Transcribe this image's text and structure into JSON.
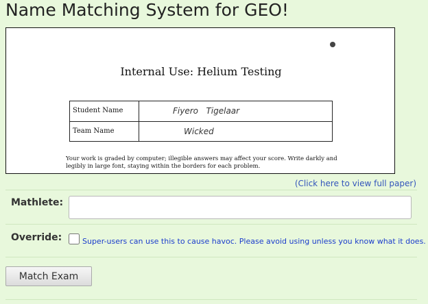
{
  "page": {
    "title": "Name Matching System for GEO!"
  },
  "exam_preview": {
    "heading": "Internal Use: Helium Testing",
    "student_name_label": "Student Name",
    "student_name_value": "Fiyero   Tigelaar",
    "team_name_label": "Team Name",
    "team_name_value": "Wicked",
    "instructions": "Your work is graded by computer; illegible answers may affect your score. Write darkly and legibly in large font, staying within the borders for each problem."
  },
  "view_full_paper_link": "(Click here to view full paper)",
  "form": {
    "mathlete_label": "Mathlete:",
    "mathlete_value": "",
    "override_label": "Override:",
    "override_checked": false,
    "override_note": "Super-users can use this to cause havoc. Please avoid using unless you know what it does.",
    "submit_label": "Match Exam"
  }
}
